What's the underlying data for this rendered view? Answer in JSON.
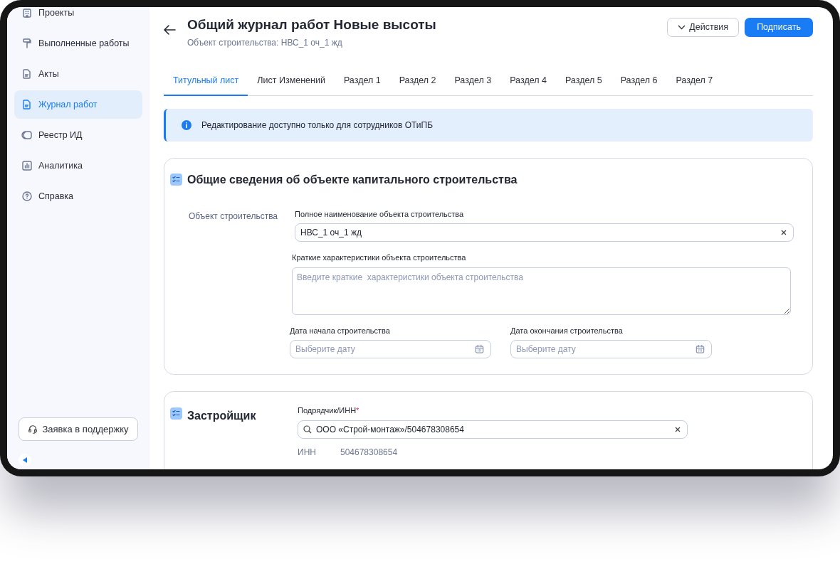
{
  "sidebar": {
    "items": [
      {
        "label": "Проекты",
        "selected": false
      },
      {
        "label": "Выполненные работы",
        "selected": false
      },
      {
        "label": "Акты",
        "selected": false
      },
      {
        "label": "Журнал работ",
        "selected": true
      },
      {
        "label": "Реестр ИД",
        "selected": false
      },
      {
        "label": "Аналитика",
        "selected": false
      },
      {
        "label": "Справка",
        "selected": false
      }
    ],
    "support_button": "Заявка в поддержку"
  },
  "header": {
    "title": "Общий журнал работ Новые высоты",
    "subtitle": "Объект строительства: НВС_1 оч_1 жд",
    "buttons": [
      {
        "label": "Действия",
        "kind": "outline"
      },
      {
        "label": "Подписать",
        "kind": "primary"
      }
    ]
  },
  "tabs": [
    {
      "label": "Титульный лист",
      "selected": true
    },
    {
      "label": "Лист Изменений",
      "selected": false
    },
    {
      "label": "Раздел 1",
      "selected": false
    },
    {
      "label": "Раздел 2",
      "selected": false
    },
    {
      "label": "Раздел 3",
      "selected": false
    },
    {
      "label": "Раздел 4",
      "selected": false
    },
    {
      "label": "Раздел 5",
      "selected": false
    },
    {
      "label": "Раздел 6",
      "selected": false
    },
    {
      "label": "Раздел 7",
      "selected": false
    }
  ],
  "alert": "Редактирование доступно только для сотрудников ОТиПБ",
  "object_section": {
    "title": "Общие сведения об объекте капитального строительства",
    "row_label": "Объект строительства",
    "fields": [
      {
        "kind": "text",
        "label": "Полное наименование объекта строительства",
        "value": "НВС_1 оч_1 жд"
      },
      {
        "kind": "textarea",
        "label": "Краткие  характеристики объекта строительства",
        "placeholder": "Введите краткие  характеристики объекта строительства"
      },
      {
        "kind": "date",
        "label": "Дата начала строительства",
        "placeholder": "Выберите дату"
      },
      {
        "kind": "date",
        "label": "Дата окончания строительства",
        "placeholder": "Выберите дату"
      }
    ]
  },
  "developer_section": {
    "title": "Застройщик",
    "field": {
      "label": "Подрядчик/ИНН",
      "required_mark": "*",
      "value": "ООО «Строй-монтаж»/504678308654"
    },
    "details": [
      {
        "label": "ИНН",
        "value": "504678308654"
      }
    ]
  }
}
